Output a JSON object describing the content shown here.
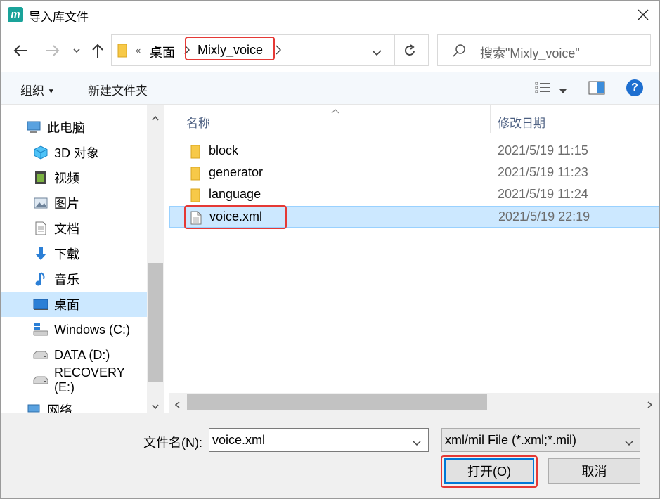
{
  "window": {
    "title": "导入库文件",
    "app_icon_glyph": "m"
  },
  "nav": {
    "back_icon": "arrow-left-icon",
    "forward_icon": "arrow-right-icon",
    "up_icon": "arrow-up-icon"
  },
  "address": {
    "overflow": "«",
    "crumbs": [
      "桌面",
      "Mixly_voice"
    ],
    "refresh_icon": "refresh-icon"
  },
  "search": {
    "placeholder": "搜索\"Mixly_voice\""
  },
  "toolbar": {
    "organize": "组织",
    "new_folder": "新建文件夹",
    "help": "?"
  },
  "sidebar": {
    "items": [
      {
        "label": "此电脑",
        "icon": "computer-icon"
      },
      {
        "label": "3D 对象",
        "icon": "cube-icon"
      },
      {
        "label": "视频",
        "icon": "video-icon"
      },
      {
        "label": "图片",
        "icon": "picture-icon"
      },
      {
        "label": "文档",
        "icon": "document-icon"
      },
      {
        "label": "下载",
        "icon": "download-icon"
      },
      {
        "label": "音乐",
        "icon": "music-icon"
      },
      {
        "label": "桌面",
        "icon": "desktop-icon"
      },
      {
        "label": "Windows (C:)",
        "icon": "drive-icon"
      },
      {
        "label": "DATA (D:)",
        "icon": "drive-icon"
      },
      {
        "label": "RECOVERY (E:)",
        "icon": "drive-icon"
      },
      {
        "label": "网络",
        "icon": "network-icon"
      }
    ],
    "selected": "桌面"
  },
  "list": {
    "columns": [
      "名称",
      "修改日期"
    ],
    "files": [
      {
        "name": "block",
        "date": "2021/5/19 11:15",
        "type": "folder"
      },
      {
        "name": "generator",
        "date": "2021/5/19 11:23",
        "type": "folder"
      },
      {
        "name": "language",
        "date": "2021/5/19 11:24",
        "type": "folder"
      },
      {
        "name": "voice.xml",
        "date": "2021/5/19 22:19",
        "type": "file"
      }
    ],
    "selected": "voice.xml"
  },
  "footer": {
    "filename_label": "文件名(N):",
    "filename_value": "voice.xml",
    "filetype_value": "xml/mil File (*.xml;*.mil)",
    "open_label": "打开(O)",
    "cancel_label": "取消"
  },
  "colors": {
    "selection": "#cce8ff",
    "highlight_box": "#e53935",
    "primary_border": "#0078d7"
  }
}
